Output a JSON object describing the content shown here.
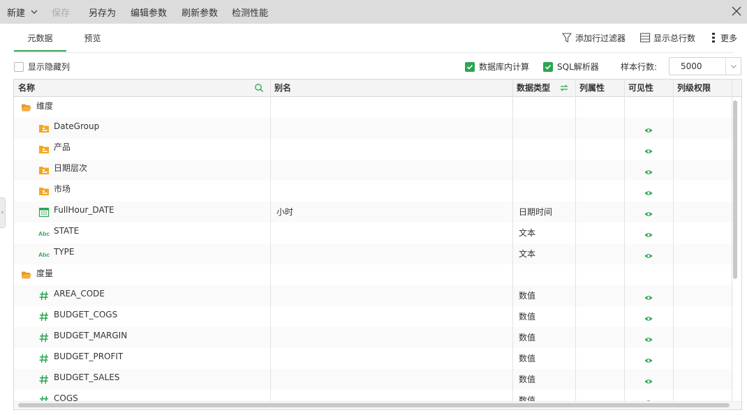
{
  "toolbar": {
    "new_label": "新建",
    "save_label": "保存",
    "save_as_label": "另存为",
    "edit_params_label": "编辑参数",
    "refresh_params_label": "刷新参数",
    "check_perf_label": "检测性能"
  },
  "tabs": [
    {
      "label": "元数据",
      "active": true
    },
    {
      "label": "预览",
      "active": false
    }
  ],
  "actions": {
    "add_filter_label": "添加行过滤器",
    "show_total_label": "显示总行数",
    "more_label": "更多"
  },
  "options": {
    "show_hidden_label": "显示隐藏列",
    "show_hidden_checked": false,
    "db_calc_label": "数据库内计算",
    "db_calc_checked": true,
    "sql_parser_label": "SQL解析器",
    "sql_parser_checked": true,
    "sample_rows_label": "样本行数:",
    "sample_rows_value": "5000"
  },
  "columns": {
    "name": "名称",
    "alias": "别名",
    "data_type": "数据类型",
    "col_property": "列属性",
    "visibility": "可见性",
    "col_permission": "列级权限"
  },
  "rows": [
    {
      "name": "维度",
      "icon": "folder-open-icon",
      "level": 0,
      "alias": "",
      "type": "",
      "visible": false
    },
    {
      "name": "DateGroup",
      "icon": "folder-hierarchy-icon",
      "level": 1,
      "alias": "",
      "type": "",
      "visible": true
    },
    {
      "name": "产品",
      "icon": "folder-hierarchy-icon",
      "level": 1,
      "alias": "",
      "type": "",
      "visible": true
    },
    {
      "name": "日期层次",
      "icon": "folder-hierarchy-icon",
      "level": 1,
      "alias": "",
      "type": "",
      "visible": true
    },
    {
      "name": "市场",
      "icon": "folder-hierarchy-icon",
      "level": 1,
      "alias": "",
      "type": "",
      "visible": true
    },
    {
      "name": "FullHour_DATE",
      "icon": "calendar-icon",
      "level": 1,
      "alias": "小时",
      "type": "日期时间",
      "visible": true
    },
    {
      "name": "STATE",
      "icon": "abc-text-icon",
      "level": 1,
      "alias": "",
      "type": "文本",
      "visible": true
    },
    {
      "name": "TYPE",
      "icon": "abc-text-icon",
      "level": 1,
      "alias": "",
      "type": "文本",
      "visible": true
    },
    {
      "name": "度量",
      "icon": "folder-open-icon",
      "level": 0,
      "alias": "",
      "type": "",
      "visible": false
    },
    {
      "name": "AREA_CODE",
      "icon": "hash-number-icon",
      "level": 1,
      "alias": "",
      "type": "数值",
      "visible": true
    },
    {
      "name": "BUDGET_COGS",
      "icon": "hash-number-icon",
      "level": 1,
      "alias": "",
      "type": "数值",
      "visible": true
    },
    {
      "name": "BUDGET_MARGIN",
      "icon": "hash-number-icon",
      "level": 1,
      "alias": "",
      "type": "数值",
      "visible": true
    },
    {
      "name": "BUDGET_PROFIT",
      "icon": "hash-number-icon",
      "level": 1,
      "alias": "",
      "type": "数值",
      "visible": true
    },
    {
      "name": "BUDGET_SALES",
      "icon": "hash-number-icon",
      "level": 1,
      "alias": "",
      "type": "数值",
      "visible": true
    },
    {
      "name": "COGS",
      "icon": "hash-number-icon",
      "level": 1,
      "alias": "",
      "type": "数值",
      "visible": true
    }
  ],
  "colors": {
    "accent": "#2ca452",
    "folder": "#f5a623"
  }
}
